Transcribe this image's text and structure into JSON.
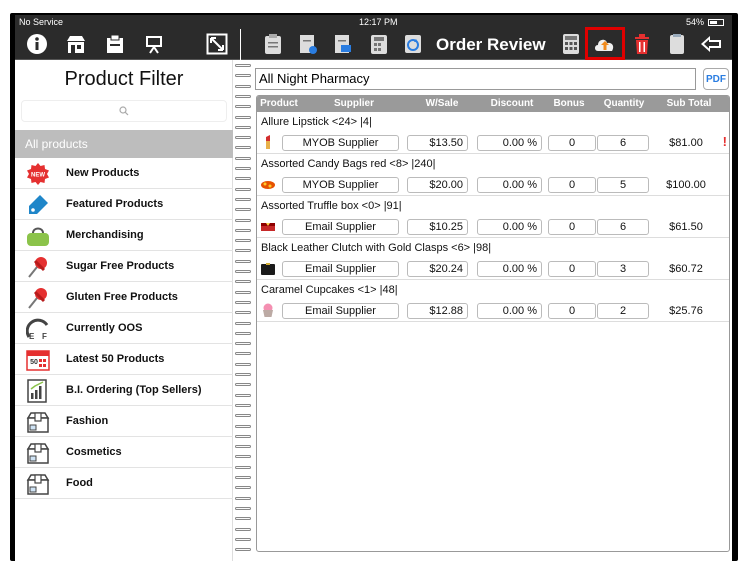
{
  "status_bar": {
    "carrier": "No Service",
    "time": "12:17 PM",
    "battery": "54%"
  },
  "toolbar": {
    "title": "Order Review",
    "left_icons": [
      "info-icon",
      "store-icon",
      "catalog-icon",
      "presentation-icon",
      "expand-icon"
    ],
    "right_icons": [
      "clipboard-icon",
      "order-export-icon",
      "document-icon",
      "calculator-doc-icon",
      "sync-icon",
      "calculator-icon",
      "upload-cloud-icon",
      "trash-icon",
      "notes-icon",
      "back-arrow-icon"
    ]
  },
  "product_filter": {
    "title": "Product Filter",
    "search_placeholder": "",
    "all_products_label": "All products",
    "categories": [
      {
        "label": "New Products",
        "icon": "new-badge-icon"
      },
      {
        "label": "Featured Products",
        "icon": "tag-icon"
      },
      {
        "label": "Merchandising",
        "icon": "bag-icon"
      },
      {
        "label": "Sugar Free Products",
        "icon": "pin-icon"
      },
      {
        "label": "Gluten Free Products",
        "icon": "pin-icon"
      },
      {
        "label": "Currently OOS",
        "icon": "oos-icon"
      },
      {
        "label": "Latest 50 Products",
        "icon": "calendar-50-icon"
      },
      {
        "label": "B.I. Ordering (Top Sellers)",
        "icon": "bar-chart-icon"
      },
      {
        "label": "Fashion",
        "icon": "box-icon"
      },
      {
        "label": "Cosmetics",
        "icon": "box-icon"
      },
      {
        "label": "Food",
        "icon": "box-icon"
      }
    ]
  },
  "order": {
    "customer": "All Night Pharmacy",
    "pdf_label": "PDF",
    "columns": [
      "Product",
      "Supplier",
      "W/Sale",
      "Discount",
      "Bonus",
      "Quantity",
      "Sub Total"
    ],
    "rows": [
      {
        "name": "Allure Lipstick <24> |4|",
        "supplier": "MYOB Supplier",
        "wsale": "$13.50",
        "discount": "0.00 %",
        "bonus": "0",
        "quantity": "6",
        "subtotal": "$81.00",
        "warning": "!",
        "thumb": "lipstick-icon"
      },
      {
        "name": "Assorted Candy Bags red <8> |240|",
        "supplier": "MYOB Supplier",
        "wsale": "$20.00",
        "discount": "0.00 %",
        "bonus": "0",
        "quantity": "5",
        "subtotal": "$100.00",
        "warning": "",
        "thumb": "candy-icon"
      },
      {
        "name": "Assorted Truffle box <0> |91|",
        "supplier": "Email Supplier",
        "wsale": "$10.25",
        "discount": "0.00 %",
        "bonus": "0",
        "quantity": "6",
        "subtotal": "$61.50",
        "warning": "",
        "thumb": "truffle-icon"
      },
      {
        "name": "Black Leather Clutch with Gold Clasps <6> |98|",
        "supplier": "Email Supplier",
        "wsale": "$20.24",
        "discount": "0.00 %",
        "bonus": "0",
        "quantity": "3",
        "subtotal": "$60.72",
        "warning": "",
        "thumb": "clutch-icon"
      },
      {
        "name": "Caramel Cupcakes <1> |48|",
        "supplier": "Email Supplier",
        "wsale": "$12.88",
        "discount": "0.00 %",
        "bonus": "0",
        "quantity": "2",
        "subtotal": "$25.76",
        "warning": "",
        "thumb": "cupcake-icon"
      }
    ]
  },
  "colors": {
    "toolbar_bg": "#2b2b2b",
    "header_bg": "#9a9a9a",
    "highlight": "#e00000",
    "accent_blue": "#2a7de1",
    "warning_red": "#e53030"
  }
}
